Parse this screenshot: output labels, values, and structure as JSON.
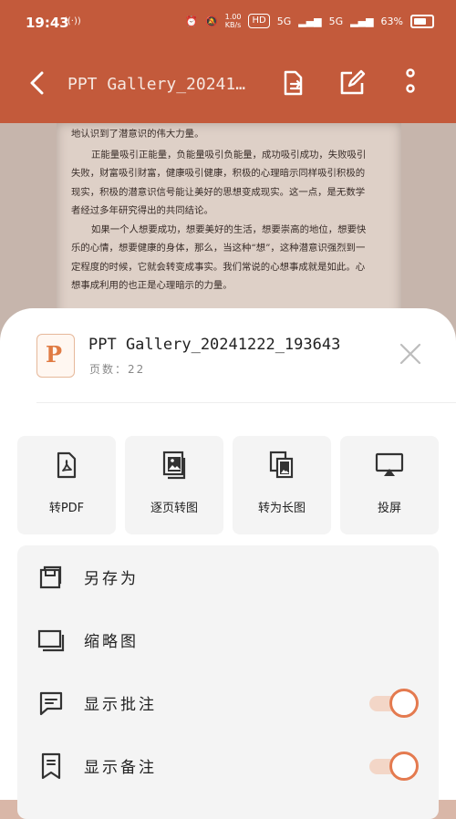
{
  "status_bar": {
    "time": "19:43",
    "net_speed": "1.00\nKB/s",
    "hd": "HD",
    "signal1": "5G",
    "signal2": "5G",
    "battery": "63%"
  },
  "app_bar": {
    "title": "PPT Gallery_20241…"
  },
  "document": {
    "lines": [
      "地认识到了潜意识的伟大力量。",
      "正能量吸引正能量，负能量吸引负能量，成功吸引成功，失败吸引失败，财富吸引财富，健康吸引健康，积极的心理暗示同样吸引积极的现实，积极的潜意识信号能让美好的思想变成现实。这一点，是无数学者经过多年研究得出的共同结论。",
      "如果一个人想要成功，想要美好的生活，想要崇高的地位，想要快乐的心情，想要健康的身体，那么，当这种“想”，这种潜意识强烈到一定程度的时候，它就会转变成事实。我们常说的心想事成就是如此。心想事成利用的也正是心理暗示的力量。"
    ]
  },
  "sheet": {
    "file_icon_letter": "P",
    "file_name": "PPT Gallery_20241222_193643",
    "pages_label": "页数：22",
    "actions": [
      {
        "label": "转PDF",
        "icon": "pdf-icon"
      },
      {
        "label": "逐页转图",
        "icon": "images-icon"
      },
      {
        "label": "转为长图",
        "icon": "long-image-icon"
      },
      {
        "label": "投屏",
        "icon": "cast-icon"
      }
    ],
    "options": [
      {
        "label": "另存为",
        "icon": "save-as-icon"
      },
      {
        "label": "缩略图",
        "icon": "thumbnail-icon"
      },
      {
        "label": "显示批注",
        "icon": "comment-icon",
        "toggle": true
      },
      {
        "label": "显示备注",
        "icon": "note-icon",
        "toggle": true
      }
    ]
  },
  "colors": {
    "accent": "#e47a4f",
    "header": "#c35a3b"
  }
}
